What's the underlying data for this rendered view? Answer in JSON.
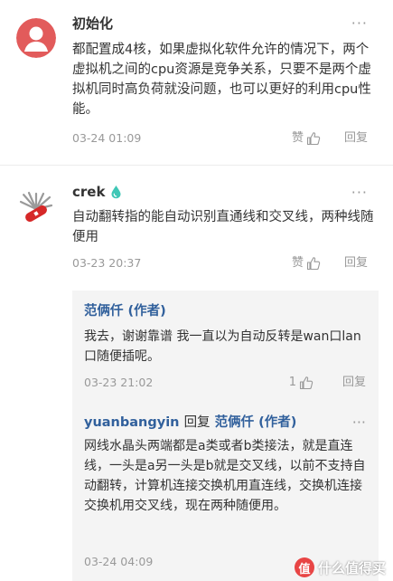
{
  "comments": [
    {
      "username": "初始化",
      "text": "都配置成4核，如果虚拟化软件允许的情况下，两个虚拟机之间的cpu资源是竞争关系，只要不是两个虚拟机同时高负荷就没问题，也可以更好的利用cpu性能。",
      "time": "03-24 01:09",
      "like_label": "赞",
      "reply_label": "回复",
      "more_label": "···"
    },
    {
      "username": "crek",
      "text": "自动翻转指的能自动识别直通线和交叉线，两种线随便用",
      "time": "03-23 20:37",
      "like_label": "赞",
      "reply_label": "回复",
      "more_label": "···"
    }
  ],
  "replies": [
    {
      "username": "范俩仟 (作者)",
      "text": "我去，谢谢靠谱 我一直以为自动反转是wan口lan口随便插呢。",
      "time": "03-23 21:02",
      "like_count": "1",
      "reply_label": "回复",
      "more_label": "···"
    },
    {
      "username": "yuanbangyin",
      "reply_word": "回复",
      "reply_to": "范俩仟 (作者)",
      "text": "网线水晶头两端都是a类或者b类接法，就是直连线，一头是a另一头是b就是交叉线，以前不支持自动翻转，计算机连接交换机用直连线，交换机连接交换机用交叉线，现在两种随便用。",
      "time": "03-24 04:09",
      "more_label": "···"
    }
  ],
  "watermark": {
    "logo_char": "值",
    "text": "什么值得买"
  },
  "colors": {
    "author_link": "#31609c",
    "muted": "#999999",
    "sub_bg": "#f4f4f4",
    "avatar_red": "#e25b5b"
  }
}
